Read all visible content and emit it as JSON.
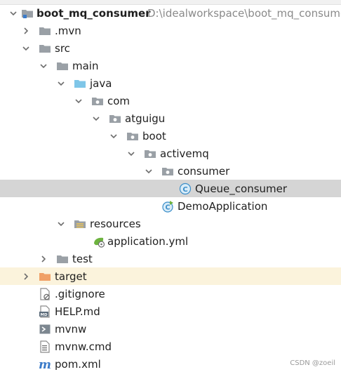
{
  "project": {
    "name": "boot_mq_consumer",
    "path": "D:\\idealworkspace\\boot_mq_consumer"
  },
  "tree": {
    "mvn": ".mvn",
    "src": "src",
    "main": "main",
    "java": "java",
    "com": "com",
    "atguigu": "atguigu",
    "boot": "boot",
    "activemq": "activemq",
    "consumer": "consumer",
    "queue_consumer": "Queue_consumer",
    "demo_application": "DemoApplication",
    "resources": "resources",
    "application_yml": "application.yml",
    "test": "test",
    "target": "target",
    "gitignore": ".gitignore",
    "help_md": "HELP.md",
    "mvnw": "mvnw",
    "mvnw_cmd": "mvnw.cmd",
    "pom_xml": "pom.xml"
  },
  "icons": {
    "folder": "folder-icon",
    "source_folder": "source-folder-icon",
    "package": "package-icon",
    "excluded_folder": "excluded-folder-icon",
    "class": "class-icon",
    "spring_boot_class": "spring-boot-class-icon",
    "resources_folder": "resources-folder-icon",
    "yml": "yml-icon",
    "ignore_file": "ignore-file-icon",
    "markdown": "markdown-icon",
    "shell": "shell-icon",
    "text_file": "text-file-icon",
    "maven": "maven-icon"
  },
  "colors": {
    "folder_gray": "#9aa0a6",
    "source_folder_blue": "#7fc6e8",
    "excluded_orange": "#f0a066",
    "selected_row": "#d5d5d5",
    "excluded_row": "#fbf3dc",
    "class_blue": "#3b8ec9",
    "spring_green": "#6db33f",
    "maven_blue": "#3b7bc9"
  },
  "watermark": "CSDN @zoeil"
}
